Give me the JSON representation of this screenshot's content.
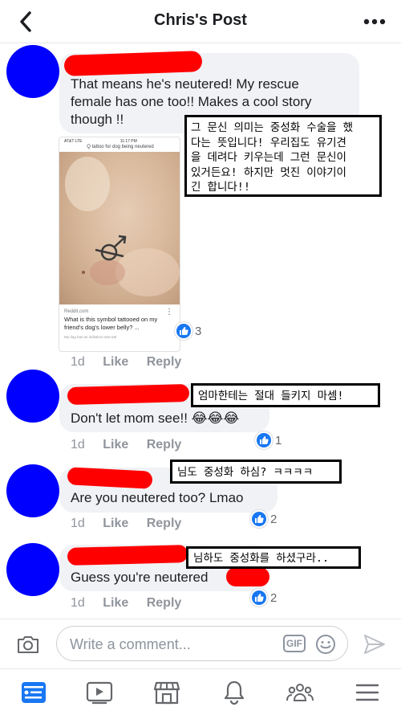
{
  "header": {
    "title": "Chris's Post"
  },
  "post": {
    "text_line1": "That means he's neutered!  My rescue",
    "text_line2": "female has one too!!  Makes a cool story",
    "text_line3": "though !!",
    "translation": [
      "그 문신 의미는 중성화 수술을 했",
      "다는 뜻입니다! 우리집도 유기견",
      "을 데려다 키우는데 그런 문신이",
      "있거든요! 하지만 멋진 이야기이",
      "긴 합니다!!"
    ],
    "shared_card": {
      "status_left": "AT&T  LTE",
      "status_time": "11:17 PM",
      "search": "Q tattoo for dog being neutered",
      "domain": "Reddit.com",
      "headline": "What is this symbol tattooed on my friend's dog's lower belly? ...",
      "sub": "My dog has an indistinct new tat!"
    },
    "time": "1d",
    "like_label": "Like",
    "reply_label": "Reply",
    "like_count": "3"
  },
  "comments": [
    {
      "text": "Don't let mom see!! 😂😂😂",
      "translation": "엄마한테는 절대 들키지 마셈!",
      "time": "1d",
      "like_label": "Like",
      "reply_label": "Reply",
      "like_count": "1"
    },
    {
      "text": "Are you neutered too? Lmao",
      "translation": "님도 중성화 하심? ㅋㅋㅋㅋ",
      "time": "1d",
      "like_label": "Like",
      "reply_label": "Reply",
      "like_count": "2"
    },
    {
      "text": "Guess you're neutered",
      "translation": "님하도 중성화를 하셨구라..",
      "time": "1d",
      "like_label": "Like",
      "reply_label": "Reply",
      "like_count": "2"
    }
  ],
  "composer": {
    "placeholder": "Write a comment...",
    "gif_label": "GIF"
  },
  "colors": {
    "accent": "#1877f2",
    "redaction": "#ff0000",
    "avatar": "#0000ff",
    "bubble": "#f0f2f5"
  },
  "icons": {
    "back": "chevron-left-icon",
    "more": "more-dots-icon",
    "camera": "camera-icon",
    "emoji": "smiley-icon",
    "send": "send-icon",
    "tabs": [
      "news-feed-icon",
      "watch-icon",
      "marketplace-icon",
      "notifications-icon",
      "groups-icon",
      "menu-icon"
    ]
  }
}
